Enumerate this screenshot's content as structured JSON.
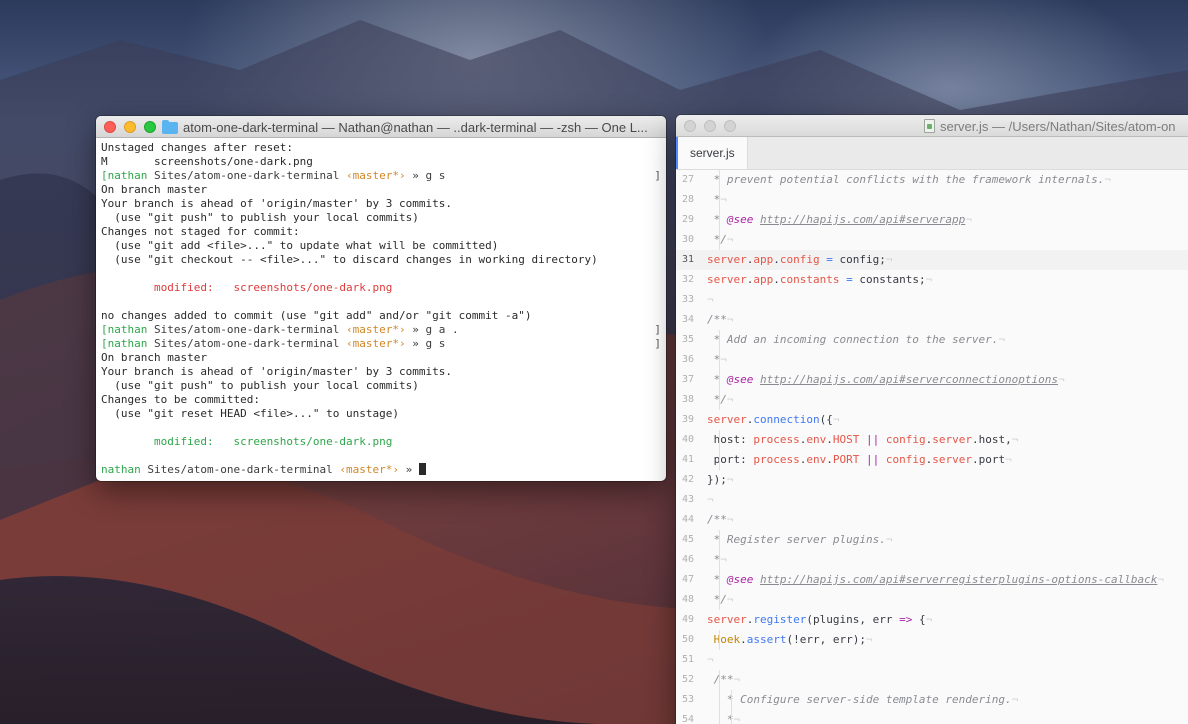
{
  "terminal": {
    "title": "atom-one-dark-terminal — Nathan@nathan — ..dark-terminal — -zsh — One L...",
    "prompt": {
      "user": "nathan",
      "path": "Sites/atom-one-dark-terminal",
      "branch": "‹master*›",
      "arrow": "»"
    },
    "lines": [
      {
        "kind": "plain",
        "text": "Unstaged changes after reset:"
      },
      {
        "kind": "plain",
        "text": "M       screenshots/one-dark.png"
      },
      {
        "kind": "prompt",
        "bracket": true,
        "cmd": "g s"
      },
      {
        "kind": "plain",
        "text": "On branch master"
      },
      {
        "kind": "plain",
        "text": "Your branch is ahead of 'origin/master' by 3 commits."
      },
      {
        "kind": "plain",
        "text": "  (use \"git push\" to publish your local commits)"
      },
      {
        "kind": "plain",
        "text": "Changes not staged for commit:"
      },
      {
        "kind": "plain",
        "text": "  (use \"git add <file>...\" to update what will be committed)"
      },
      {
        "kind": "plain",
        "text": "  (use \"git checkout -- <file>...\" to discard changes in working directory)"
      },
      {
        "kind": "plain",
        "text": ""
      },
      {
        "kind": "modified-red",
        "label": "        modified:   ",
        "file": "screenshots/one-dark.png"
      },
      {
        "kind": "plain",
        "text": ""
      },
      {
        "kind": "plain",
        "text": "no changes added to commit (use \"git add\" and/or \"git commit -a\")"
      },
      {
        "kind": "prompt",
        "bracket": true,
        "cmd": "g a ."
      },
      {
        "kind": "prompt",
        "bracket": true,
        "cmd": "g s"
      },
      {
        "kind": "plain",
        "text": "On branch master"
      },
      {
        "kind": "plain",
        "text": "Your branch is ahead of 'origin/master' by 3 commits."
      },
      {
        "kind": "plain",
        "text": "  (use \"git push\" to publish your local commits)"
      },
      {
        "kind": "plain",
        "text": "Changes to be committed:"
      },
      {
        "kind": "plain",
        "text": "  (use \"git reset HEAD <file>...\" to unstage)"
      },
      {
        "kind": "plain",
        "text": ""
      },
      {
        "kind": "modified-green",
        "label": "        modified:   ",
        "file": "screenshots/one-dark.png"
      },
      {
        "kind": "plain",
        "text": ""
      },
      {
        "kind": "prompt",
        "bracket": false,
        "cmd": "",
        "cursor": true
      }
    ]
  },
  "editor": {
    "title": "server.js — /Users/Nathan/Sites/atom-on",
    "tab_label": "server.js",
    "active_line": 31,
    "lines": [
      {
        "n": 27,
        "indent": 1,
        "parts": [
          [
            "cm",
            "* prevent potential conflicts with the framework internals."
          ],
          [
            "ws",
            "¬"
          ]
        ]
      },
      {
        "n": 28,
        "indent": 1,
        "parts": [
          [
            "cm",
            "*"
          ],
          [
            "ws",
            "¬"
          ]
        ]
      },
      {
        "n": 29,
        "indent": 1,
        "parts": [
          [
            "cm",
            "* "
          ],
          [
            "tag",
            "@see"
          ],
          [
            "cm",
            " "
          ],
          [
            "link",
            "http://hapijs.com/api#serverapp"
          ],
          [
            "ws",
            "¬"
          ]
        ]
      },
      {
        "n": 30,
        "indent": 1,
        "parts": [
          [
            "cm",
            "*/"
          ],
          [
            "ws",
            "¬"
          ]
        ]
      },
      {
        "n": 31,
        "indent": 0,
        "parts": [
          [
            "red",
            "server"
          ],
          [
            "plain",
            "."
          ],
          [
            "red",
            "app"
          ],
          [
            "plain",
            "."
          ],
          [
            "red",
            "config"
          ],
          [
            "plain",
            " "
          ],
          [
            "blue",
            "="
          ],
          [
            "plain",
            " config;"
          ],
          [
            "ws",
            "¬"
          ]
        ]
      },
      {
        "n": 32,
        "indent": 0,
        "parts": [
          [
            "red",
            "server"
          ],
          [
            "plain",
            "."
          ],
          [
            "red",
            "app"
          ],
          [
            "plain",
            "."
          ],
          [
            "red",
            "constants"
          ],
          [
            "plain",
            " "
          ],
          [
            "blue",
            "="
          ],
          [
            "plain",
            " constants;"
          ],
          [
            "ws",
            "¬"
          ]
        ]
      },
      {
        "n": 33,
        "indent": 0,
        "parts": [
          [
            "ws",
            "¬"
          ]
        ]
      },
      {
        "n": 34,
        "indent": 0,
        "parts": [
          [
            "cm",
            "/**"
          ],
          [
            "ws",
            "¬"
          ]
        ]
      },
      {
        "n": 35,
        "indent": 1,
        "parts": [
          [
            "cm",
            "* Add an incoming connection to the server."
          ],
          [
            "ws",
            "¬"
          ]
        ]
      },
      {
        "n": 36,
        "indent": 1,
        "parts": [
          [
            "cm",
            "*"
          ],
          [
            "ws",
            "¬"
          ]
        ]
      },
      {
        "n": 37,
        "indent": 1,
        "parts": [
          [
            "cm",
            "* "
          ],
          [
            "tag",
            "@see"
          ],
          [
            "cm",
            " "
          ],
          [
            "link",
            "http://hapijs.com/api#serverconnectionoptions"
          ],
          [
            "ws",
            "¬"
          ]
        ]
      },
      {
        "n": 38,
        "indent": 1,
        "parts": [
          [
            "cm",
            "*/"
          ],
          [
            "ws",
            "¬"
          ]
        ]
      },
      {
        "n": 39,
        "indent": 0,
        "parts": [
          [
            "red",
            "server"
          ],
          [
            "plain",
            "."
          ],
          [
            "blue",
            "connection"
          ],
          [
            "plain",
            "({"
          ],
          [
            "ws",
            "¬"
          ]
        ]
      },
      {
        "n": 40,
        "indent": 1,
        "parts": [
          [
            "plain",
            "host: "
          ],
          [
            "red",
            "process"
          ],
          [
            "plain",
            "."
          ],
          [
            "red",
            "env"
          ],
          [
            "plain",
            "."
          ],
          [
            "red",
            "HOST"
          ],
          [
            "plain",
            " "
          ],
          [
            "purple",
            "||"
          ],
          [
            "plain",
            " "
          ],
          [
            "red",
            "config"
          ],
          [
            "plain",
            "."
          ],
          [
            "red",
            "server"
          ],
          [
            "plain",
            ".host,"
          ],
          [
            "ws",
            "¬"
          ]
        ]
      },
      {
        "n": 41,
        "indent": 1,
        "parts": [
          [
            "plain",
            "port: "
          ],
          [
            "red",
            "process"
          ],
          [
            "plain",
            "."
          ],
          [
            "red",
            "env"
          ],
          [
            "plain",
            "."
          ],
          [
            "red",
            "PORT"
          ],
          [
            "plain",
            " "
          ],
          [
            "purple",
            "||"
          ],
          [
            "plain",
            " "
          ],
          [
            "red",
            "config"
          ],
          [
            "plain",
            "."
          ],
          [
            "red",
            "server"
          ],
          [
            "plain",
            ".port"
          ],
          [
            "ws",
            "¬"
          ]
        ]
      },
      {
        "n": 42,
        "indent": 0,
        "parts": [
          [
            "plain",
            "});"
          ],
          [
            "ws",
            "¬"
          ]
        ]
      },
      {
        "n": 43,
        "indent": 0,
        "parts": [
          [
            "ws",
            "¬"
          ]
        ]
      },
      {
        "n": 44,
        "indent": 0,
        "parts": [
          [
            "cm",
            "/**"
          ],
          [
            "ws",
            "¬"
          ]
        ]
      },
      {
        "n": 45,
        "indent": 1,
        "parts": [
          [
            "cm",
            "* Register server plugins."
          ],
          [
            "ws",
            "¬"
          ]
        ]
      },
      {
        "n": 46,
        "indent": 1,
        "parts": [
          [
            "cm",
            "*"
          ],
          [
            "ws",
            "¬"
          ]
        ]
      },
      {
        "n": 47,
        "indent": 1,
        "parts": [
          [
            "cm",
            "* "
          ],
          [
            "tag",
            "@see"
          ],
          [
            "cm",
            " "
          ],
          [
            "link",
            "http://hapijs.com/api#serverregisterplugins-options-callback"
          ],
          [
            "ws",
            "¬"
          ]
        ]
      },
      {
        "n": 48,
        "indent": 1,
        "parts": [
          [
            "cm",
            "*/"
          ],
          [
            "ws",
            "¬"
          ]
        ]
      },
      {
        "n": 49,
        "indent": 0,
        "parts": [
          [
            "red",
            "server"
          ],
          [
            "plain",
            "."
          ],
          [
            "blue",
            "register"
          ],
          [
            "plain",
            "(plugins, err "
          ],
          [
            "purple",
            "=>"
          ],
          [
            "plain",
            " {"
          ],
          [
            "ws",
            "¬"
          ]
        ]
      },
      {
        "n": 50,
        "indent": 1,
        "parts": [
          [
            "orange",
            "Hoek"
          ],
          [
            "plain",
            "."
          ],
          [
            "blue",
            "assert"
          ],
          [
            "plain",
            "(!err, err);"
          ],
          [
            "ws",
            "¬"
          ]
        ]
      },
      {
        "n": 51,
        "indent": 0,
        "parts": [
          [
            "ws",
            "¬"
          ]
        ]
      },
      {
        "n": 52,
        "indent": 1,
        "parts": [
          [
            "cm",
            "/**"
          ],
          [
            "ws",
            "¬"
          ]
        ]
      },
      {
        "n": 53,
        "indent": 2,
        "parts": [
          [
            "cm",
            "* Configure server-side template rendering."
          ],
          [
            "ws",
            "¬"
          ]
        ]
      },
      {
        "n": 54,
        "indent": 2,
        "parts": [
          [
            "cm",
            "*"
          ],
          [
            "ws",
            "¬"
          ]
        ]
      }
    ]
  }
}
